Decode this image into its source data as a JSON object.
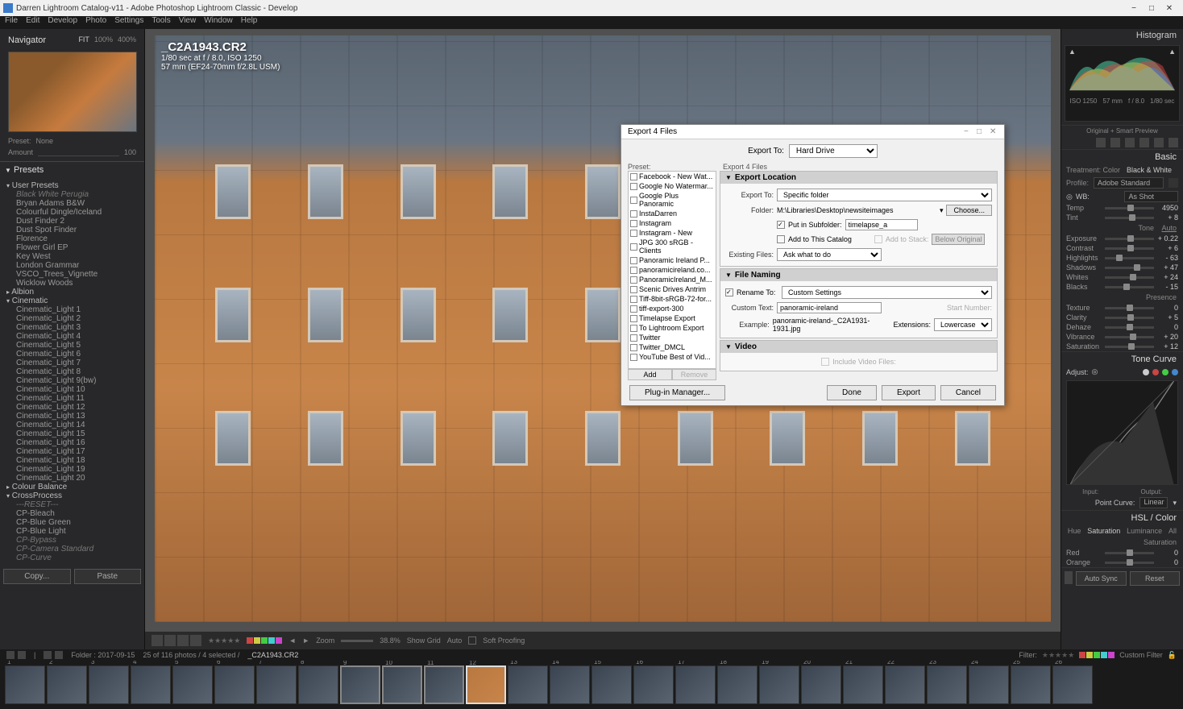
{
  "titlebar": {
    "title": "Darren Lightroom Catalog-v11 - Adobe Photoshop Lightroom Classic - Develop"
  },
  "menubar": [
    "File",
    "Edit",
    "Develop",
    "Photo",
    "Settings",
    "Tools",
    "View",
    "Window",
    "Help"
  ],
  "navigator": {
    "title": "Navigator",
    "zoom_levels": [
      "FIT",
      "100%",
      "400%"
    ],
    "preset_label": "Preset:",
    "preset_value": "None",
    "amount_label": "Amount",
    "amount_value": "100"
  },
  "presets": {
    "title": "Presets",
    "groups": [
      {
        "name": "User Presets",
        "expanded": true,
        "items": [
          {
            "label": "Black White Perugia",
            "italic": true
          },
          {
            "label": "Bryan Adams B&W"
          },
          {
            "label": "Colourful Dingle/Iceland"
          },
          {
            "label": "Dust Finder 2"
          },
          {
            "label": "Dust Spot Finder"
          },
          {
            "label": "Florence"
          },
          {
            "label": "Flower Girl EP"
          },
          {
            "label": "Key West"
          },
          {
            "label": "London Grammar"
          },
          {
            "label": "VSCO_Trees_Vignette"
          },
          {
            "label": "Wicklow Woods"
          }
        ]
      },
      {
        "name": "Albion",
        "expanded": false,
        "items": []
      },
      {
        "name": "Cinematic",
        "expanded": true,
        "items": [
          {
            "label": "Cinematic_Light 1"
          },
          {
            "label": "Cinematic_Light 2"
          },
          {
            "label": "Cinematic_Light 3"
          },
          {
            "label": "Cinematic_Light 4"
          },
          {
            "label": "Cinematic_Light 5"
          },
          {
            "label": "Cinematic_Light 6"
          },
          {
            "label": "Cinematic_Light 7"
          },
          {
            "label": "Cinematic_Light 8"
          },
          {
            "label": "Cinematic_Light 9(bw)"
          },
          {
            "label": "Cinematic_Light 10"
          },
          {
            "label": "Cinematic_Light 11"
          },
          {
            "label": "Cinematic_Light 12"
          },
          {
            "label": "Cinematic_Light 13"
          },
          {
            "label": "Cinematic_Light 14"
          },
          {
            "label": "Cinematic_Light 15"
          },
          {
            "label": "Cinematic_Light 16"
          },
          {
            "label": "Cinematic_Light 17"
          },
          {
            "label": "Cinematic_Light 18"
          },
          {
            "label": "Cinematic_Light 19"
          },
          {
            "label": "Cinematic_Light 20"
          }
        ]
      },
      {
        "name": "Colour Balance",
        "expanded": false,
        "items": []
      },
      {
        "name": "CrossProcess",
        "expanded": true,
        "items": [
          {
            "label": "---RESET---",
            "italic": true
          },
          {
            "label": "CP-Bleach"
          },
          {
            "label": "CP-Blue Green"
          },
          {
            "label": "CP-Blue Light"
          },
          {
            "label": "CP-Bypass",
            "italic": true
          },
          {
            "label": "CP-Camera Standard",
            "italic": true
          },
          {
            "label": "CP-Curve",
            "italic": true
          }
        ]
      }
    ]
  },
  "copy_paste": {
    "copy": "Copy...",
    "paste": "Paste"
  },
  "photo_info": {
    "filename": "_C2A1943.CR2",
    "exposure": "1/80 sec at f / 8.0, ISO 1250",
    "lens": "57 mm (EF24-70mm f/2.8L USM)"
  },
  "bottom_toolbar": {
    "zoom_label": "Zoom",
    "zoom_pct": "38.8%",
    "show_grid": "Show Grid",
    "auto": "Auto",
    "soft_proofing": "Soft Proofing"
  },
  "right": {
    "histogram_title": "Histogram",
    "histo_meta": [
      "ISO 1250",
      "57 mm",
      "f / 8.0",
      "1/80 sec"
    ],
    "orig_preview": "Original + Smart Preview",
    "basic": {
      "title": "Basic",
      "treatment": "Treatment:",
      "color": "Color",
      "bw": "Black & White",
      "profile_label": "Profile:",
      "profile_value": "Adobe Standard",
      "wb_label": "WB:",
      "wb_value": "As Shot",
      "tone_label": "Tone",
      "auto": "Auto",
      "presence": "Presence",
      "sliders": [
        {
          "label": "Temp",
          "value": "4950",
          "pos": 52
        },
        {
          "label": "Tint",
          "value": "+ 8",
          "pos": 55
        },
        {
          "label": "Exposure",
          "value": "+ 0.22",
          "pos": 52
        },
        {
          "label": "Contrast",
          "value": "+ 6",
          "pos": 53
        },
        {
          "label": "Highlights",
          "value": "- 63",
          "pos": 30
        },
        {
          "label": "Shadows",
          "value": "+ 47",
          "pos": 65
        },
        {
          "label": "Whites",
          "value": "+ 24",
          "pos": 58
        },
        {
          "label": "Blacks",
          "value": "- 15",
          "pos": 45
        },
        {
          "label": "Texture",
          "value": "0",
          "pos": 50
        },
        {
          "label": "Clarity",
          "value": "+ 5",
          "pos": 52
        },
        {
          "label": "Dehaze",
          "value": "0",
          "pos": 50
        },
        {
          "label": "Vibrance",
          "value": "+ 20",
          "pos": 57
        },
        {
          "label": "Saturation",
          "value": "+ 12",
          "pos": 54
        }
      ]
    },
    "tone_curve": {
      "title": "Tone Curve",
      "adjust": "Adjust:",
      "input": "Input:",
      "output": "Output:",
      "point_curve": "Point Curve:",
      "point_value": "Linear"
    },
    "hsl": {
      "title": "HSL / Color",
      "tabs": [
        "Hue",
        "Saturation",
        "Luminance",
        "All"
      ],
      "active_tab": "Saturation",
      "sat_label": "Saturation",
      "sliders": [
        {
          "label": "Red",
          "value": "0",
          "pos": 50
        },
        {
          "label": "Orange",
          "value": "0",
          "pos": 50
        }
      ]
    },
    "autosync": {
      "auto_sync": "Auto Sync",
      "reset": "Reset"
    }
  },
  "filmstrip": {
    "folder_label": "Folder : 2017-09-15",
    "count": "25 of 116 photos / 4 selected /",
    "filename": "_C2A1943.CR2",
    "filter_label": "Filter:",
    "custom_filter": "Custom Filter",
    "thumb_count": 26,
    "selected_indices": [
      9,
      10,
      11,
      12
    ],
    "current_index": 12
  },
  "export_dialog": {
    "title": "Export 4 Files",
    "export_to_label": "Export To:",
    "export_to_value": "Hard Drive",
    "preset_label": "Preset:",
    "files_label": "Export 4 Files",
    "preset_items": [
      "Facebook - New Wat...",
      "Google No Watermar...",
      "Google Plus Panoramic",
      "InstaDarren",
      "Instagram",
      "Instagram - New",
      "JPG 300 sRGB - Clients",
      "Panoramic Ireland P...",
      "panoramicireland.co...",
      "PanoramicIreland_M...",
      "Scenic Drives Antrim",
      "Tiff-8bit-sRGB-72-for...",
      "tiff-export-300",
      "Timelapse Export",
      "To Lightroom Export",
      "Twitter",
      "Twitter_DMCL",
      "YouTube Best of Vid..."
    ],
    "add_btn": "Add",
    "remove_btn": "Remove",
    "location": {
      "header": "Export Location",
      "export_to_label": "Export To:",
      "export_to_value": "Specific folder",
      "folder_label": "Folder:",
      "folder_value": "M:\\Libraries\\Desktop\\newsiteimages",
      "choose": "Choose...",
      "put_subfolder": "Put in Subfolder:",
      "subfolder_value": "timelapse_a",
      "add_catalog": "Add to This Catalog",
      "add_stack": "Add to Stack:",
      "stack_value": "Below Original",
      "existing_label": "Existing Files:",
      "existing_value": "Ask what to do"
    },
    "naming": {
      "header": "File Naming",
      "rename_label": "Rename To:",
      "rename_value": "Custom Settings",
      "custom_text_label": "Custom Text:",
      "custom_text_value": "panoramic-ireland",
      "start_num_label": "Start Number:",
      "example_label": "Example:",
      "example_value": "panoramic-ireland-_C2A1931-1931.jpg",
      "ext_label": "Extensions:",
      "ext_value": "Lowercase"
    },
    "video": {
      "header": "Video",
      "include": "Include Video Files:"
    },
    "plugin_mgr": "Plug-in Manager...",
    "done": "Done",
    "export": "Export",
    "cancel": "Cancel"
  }
}
